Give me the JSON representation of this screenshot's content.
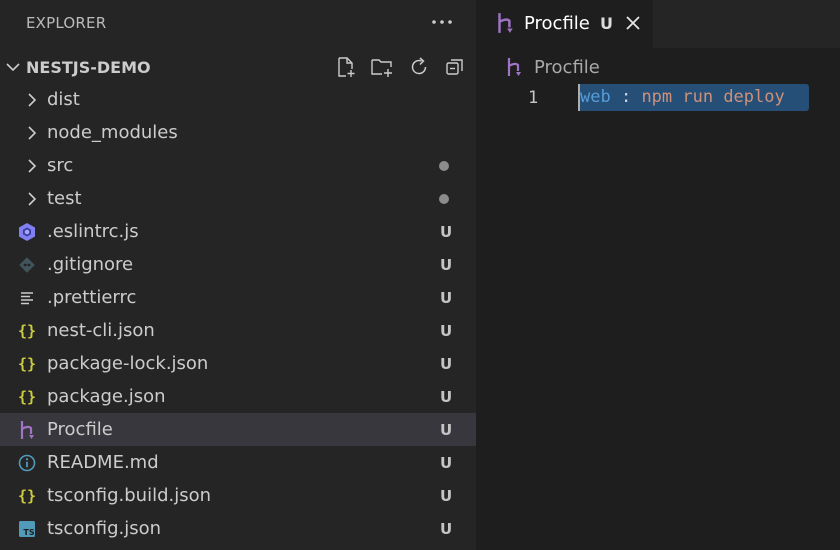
{
  "explorer": {
    "title": "EXPLORER",
    "more_actions_icon": "ellipsis-icon",
    "folder": {
      "name": "NESTJS-DEMO",
      "actions": [
        "new-file-icon",
        "new-folder-icon",
        "refresh-icon",
        "collapse-all-icon"
      ]
    },
    "items": [
      {
        "label": "dist",
        "type": "folder",
        "status": ""
      },
      {
        "label": "node_modules",
        "type": "folder",
        "status": ""
      },
      {
        "label": "src",
        "type": "folder",
        "status": "dot"
      },
      {
        "label": "test",
        "type": "folder",
        "status": "dot"
      },
      {
        "label": ".eslintrc.js",
        "type": "eslint",
        "status": "U"
      },
      {
        "label": ".gitignore",
        "type": "git",
        "status": "U"
      },
      {
        "label": ".prettierrc",
        "type": "lines",
        "status": "U"
      },
      {
        "label": "nest-cli.json",
        "type": "json",
        "status": "U"
      },
      {
        "label": "package-lock.json",
        "type": "json",
        "status": "U"
      },
      {
        "label": "package.json",
        "type": "json",
        "status": "U"
      },
      {
        "label": "Procfile",
        "type": "heroku",
        "status": "U",
        "selected": true
      },
      {
        "label": "README.md",
        "type": "info",
        "status": "U"
      },
      {
        "label": "tsconfig.build.json",
        "type": "json",
        "status": "U"
      },
      {
        "label": "tsconfig.json",
        "type": "ts",
        "status": "U"
      }
    ]
  },
  "editor": {
    "tab": {
      "label": "Procfile",
      "status": "U",
      "close_icon": "close-icon"
    },
    "breadcrumb": {
      "label": "Procfile"
    },
    "lines": [
      {
        "number": "1",
        "tokens": [
          {
            "text": "web",
            "kind": "key"
          },
          {
            "text": " : ",
            "kind": "punc"
          },
          {
            "text": "npm run deploy",
            "kind": "cmd"
          }
        ]
      }
    ]
  },
  "colors": {
    "sidebar_bg": "#252526",
    "editor_bg": "#1e1e1e",
    "selection": "#264f78",
    "selected_row": "#37373d",
    "heroku_purple": "#a074c4",
    "json_yellow": "#cbcb41",
    "info_blue": "#519aba"
  }
}
